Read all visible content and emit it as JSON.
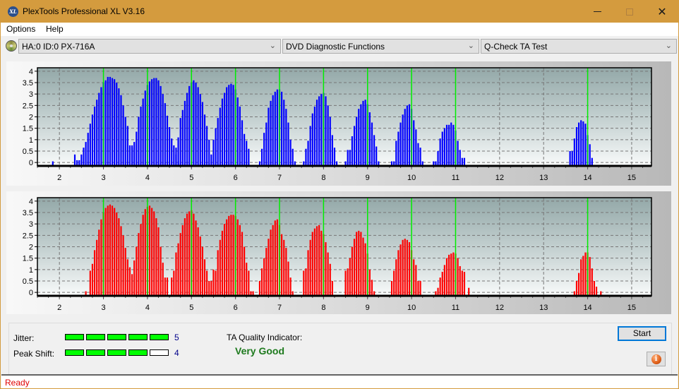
{
  "window": {
    "title": "PlexTools Professional XL V3.16",
    "app_icon_text": "XL",
    "controls": {
      "minimize": "minimize",
      "maximize": "maximize",
      "close": "✕"
    }
  },
  "menu": {
    "items": [
      {
        "label": "Options"
      },
      {
        "label": "Help"
      }
    ]
  },
  "toolbar": {
    "drive": {
      "value": "HA:0 ID:0  PX-716A"
    },
    "function": {
      "value": "DVD Diagnostic Functions"
    },
    "test": {
      "value": "Q-Check TA Test"
    },
    "chevron": "⌄"
  },
  "colors": {
    "title_bar": "#d49b3e",
    "top_chart_bars": "#0000ff",
    "bottom_chart_bars": "#ff0000",
    "marker_lines": "#00ee00",
    "meter_on": "#00ff00",
    "quality_text": "#1e7a1e",
    "status_text": "#e00000"
  },
  "chart_data": [
    {
      "type": "bar",
      "name": "ta-land-distribution",
      "bar_color": "#0000ff",
      "xlim": [
        1.5,
        15.45
      ],
      "ylim": [
        -0.15,
        4.15
      ],
      "x_ticks": [
        2,
        3,
        4,
        5,
        6,
        7,
        8,
        9,
        10,
        11,
        12,
        13,
        14,
        15
      ],
      "y_ticks": [
        0,
        0.5,
        1,
        1.5,
        2,
        2.5,
        3,
        3.5,
        4
      ],
      "y_tick_labels": [
        "0",
        "0.5",
        "1",
        "1.5",
        "2",
        "2.5",
        "3",
        "3.5",
        "4"
      ],
      "grid": true,
      "reference_lines_x": [
        3,
        4,
        5,
        6,
        7,
        8,
        9,
        10,
        11,
        14
      ],
      "bin_width": 0.05,
      "series": [
        {
          "x0": 1.85,
          "values": [
            0.05
          ]
        },
        {
          "x0": 2.35,
          "values": [
            0.35,
            0.1,
            0.1,
            0.35,
            0.65,
            0.9,
            1.3,
            1.7,
            2.1,
            2.45,
            2.75,
            3.05,
            3.3,
            3.5,
            3.6,
            3.75,
            3.75,
            3.7,
            3.65,
            3.5,
            3.25,
            2.95,
            2.5,
            2.0,
            1.6,
            0.75,
            0.75
          ]
        },
        {
          "x0": 3.65,
          "values": [
            0.65,
            0.9,
            1.35,
            2.0,
            2.45,
            2.8,
            3.15,
            3.4,
            3.55,
            3.65,
            3.7,
            3.7,
            3.6,
            3.35,
            3.0,
            2.6,
            2.05,
            1.55,
            1.05,
            0.75,
            0.35,
            0.05
          ]
        },
        {
          "x0": 4.65,
          "values": [
            0.65,
            1.1,
            1.95,
            2.3,
            2.7,
            3.05,
            3.35,
            3.5,
            3.6,
            3.5,
            3.3,
            3.0,
            2.65,
            2.1,
            1.6,
            1.0
          ]
        },
        {
          "x0": 5.45,
          "values": [
            0.35,
            1.0,
            1.5,
            1.95,
            2.4,
            2.8,
            3.05,
            3.3,
            3.4,
            3.45,
            3.4,
            3.2,
            2.85,
            2.45,
            1.85,
            1.25,
            0.95,
            0.6
          ]
        },
        {
          "x0": 6.55,
          "values": [
            0.05,
            0.6,
            1.3,
            1.75,
            2.4,
            2.7,
            2.95,
            3.1,
            3.2,
            3.2,
            3.1,
            2.75,
            2.35,
            1.75,
            1.0,
            0.6,
            0.05
          ]
        },
        {
          "x0": 7.55,
          "values": [
            0.05,
            0.6,
            0.95,
            1.6,
            2.15,
            2.45,
            2.75,
            2.9,
            3.0,
            3.05,
            2.9,
            2.5,
            2.0,
            1.2,
            0.65,
            0.05
          ]
        },
        {
          "x0": 8.5,
          "values": [
            0.05,
            0.55,
            0.55,
            1.15,
            1.6,
            2.0,
            2.35,
            2.55,
            2.7,
            2.75,
            2.55,
            2.2,
            1.75,
            1.2,
            0.7,
            0.05
          ]
        },
        {
          "x0": 9.55,
          "values": [
            0.05,
            0.05,
            0.95,
            1.35,
            1.75,
            2.1,
            2.35,
            2.5,
            2.55,
            2.35,
            1.85,
            1.45,
            0.85,
            0.65,
            0.05
          ]
        },
        {
          "x0": 10.5,
          "values": [
            0.05,
            0.05,
            0.5,
            1.05,
            1.35,
            1.5,
            1.65,
            1.65,
            1.75,
            1.65,
            1.4,
            0.95,
            0.55,
            0.2,
            0.2
          ]
        },
        {
          "x0": 13.6,
          "values": [
            0.5,
            0.5,
            1.05,
            1.55,
            1.75,
            1.85,
            1.8,
            1.7,
            1.2,
            0.8,
            0.2
          ]
        }
      ]
    },
    {
      "type": "bar",
      "name": "ta-pit-distribution",
      "bar_color": "#ff0000",
      "xlim": [
        1.5,
        15.45
      ],
      "ylim": [
        -0.15,
        4.15
      ],
      "x_ticks": [
        2,
        3,
        4,
        5,
        6,
        7,
        8,
        9,
        10,
        11,
        12,
        13,
        14,
        15
      ],
      "y_ticks": [
        0,
        0.5,
        1,
        1.5,
        2,
        2.5,
        3,
        3.5,
        4
      ],
      "y_tick_labels": [
        "0",
        "0.5",
        "1",
        "1.5",
        "2",
        "2.5",
        "3",
        "3.5",
        "4"
      ],
      "grid": true,
      "reference_lines_x": [
        3,
        4,
        5,
        6,
        7,
        8,
        9,
        10,
        11,
        14
      ],
      "bin_width": 0.05,
      "series": [
        {
          "x0": 2.6,
          "values": [
            0.05,
            0.0,
            0.95,
            1.25,
            1.85,
            2.3,
            2.75,
            3.2,
            3.5,
            3.7,
            3.8,
            3.85,
            3.8,
            3.7,
            3.5,
            3.25,
            2.9,
            2.5,
            1.95,
            1.45,
            1.1
          ]
        },
        {
          "x0": 3.65,
          "values": [
            0.8,
            1.4,
            2.0,
            2.6,
            3.0,
            3.4,
            3.65,
            3.75,
            3.8,
            3.7,
            3.55,
            3.25,
            2.85,
            2.0,
            1.3,
            0.65,
            0.65,
            0.0,
            0.65
          ]
        },
        {
          "x0": 4.6,
          "values": [
            0.95,
            1.75,
            2.15,
            2.6,
            2.95,
            3.25,
            3.45,
            3.55,
            3.6,
            3.45,
            3.15,
            2.85,
            2.45,
            2.0,
            1.45,
            0.95,
            0.5,
            0.5
          ]
        },
        {
          "x0": 5.45,
          "values": [
            0.05,
            1.0,
            0.95,
            1.85,
            2.3,
            2.7,
            3.0,
            3.2,
            3.35,
            3.4,
            3.4,
            3.35,
            3.2,
            2.95,
            2.65,
            2.0,
            1.3,
            0.95,
            0.05,
            0.05
          ]
        },
        {
          "x0": 6.55,
          "values": [
            0.5,
            1.05,
            1.5,
            1.95,
            2.35,
            2.75,
            2.95,
            3.15,
            3.2,
            2.95,
            2.55,
            2.3,
            1.95,
            1.35,
            0.65,
            0.05
          ]
        },
        {
          "x0": 7.55,
          "values": [
            0.95,
            1.05,
            1.85,
            2.3,
            2.65,
            2.8,
            2.9,
            2.95,
            2.7,
            2.55,
            2.2,
            1.75,
            1.25,
            0.5
          ]
        },
        {
          "x0": 8.5,
          "values": [
            0.95,
            1.05,
            1.5,
            2.0,
            2.35,
            2.65,
            2.7,
            2.65,
            2.4,
            2.15,
            1.7,
            1.0,
            0.55,
            0.05
          ]
        },
        {
          "x0": 9.55,
          "values": [
            0.5,
            0.95,
            1.45,
            1.85,
            2.1,
            2.3,
            2.35,
            2.3,
            2.2,
            1.85,
            1.45,
            1.2,
            0.5,
            0.5
          ]
        },
        {
          "x0": 10.55,
          "values": [
            0.05,
            0.2,
            0.65,
            0.9,
            1.2,
            1.5,
            1.65,
            1.7,
            1.75,
            1.7,
            1.5,
            1.15,
            0.95,
            0.9,
            0.0,
            0.2
          ]
        },
        {
          "x0": 13.7,
          "values": [
            0.05,
            0.5,
            0.85,
            1.45,
            1.6,
            1.75,
            1.75,
            1.55,
            1.05,
            0.5,
            0.25,
            0.0,
            0.05
          ]
        }
      ]
    }
  ],
  "results": {
    "jitter": {
      "label": "Jitter:",
      "score": 5,
      "max": 5,
      "value_text": "5"
    },
    "peak_shift": {
      "label": "Peak Shift:",
      "score": 4,
      "max": 5,
      "value_text": "4"
    },
    "ta_quality": {
      "label": "TA Quality Indicator:",
      "value": "Very Good"
    }
  },
  "buttons": {
    "start": "Start",
    "info": "i"
  },
  "status": {
    "text": "Ready"
  }
}
